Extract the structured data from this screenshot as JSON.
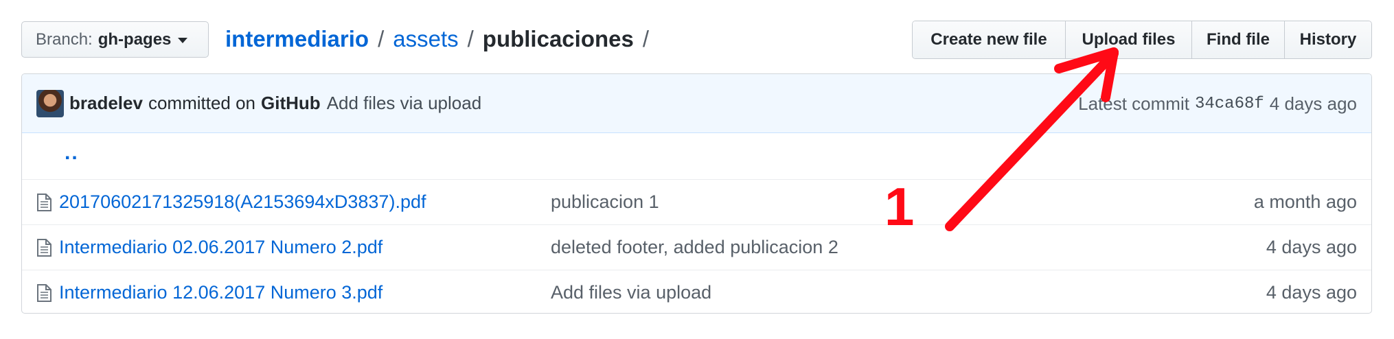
{
  "branch": {
    "label": "Branch:",
    "name": "gh-pages"
  },
  "breadcrumb": {
    "repo": "intermediario",
    "sep": "/",
    "folder": "assets",
    "current": "publicaciones"
  },
  "actions": [
    {
      "label": "Create new file"
    },
    {
      "label": "Upload files"
    },
    {
      "label": "Find file"
    },
    {
      "label": "History"
    }
  ],
  "commit": {
    "author": "bradelev",
    "committed_text": "committed on",
    "platform": "GitHub",
    "message": "Add files via upload",
    "latest_label": "Latest commit",
    "sha": "34ca68f",
    "age": "4 days ago"
  },
  "parent_link": "..",
  "files": [
    {
      "icon": "file-icon",
      "name": "20170602171325918(A2153694xD3837).pdf",
      "message": "publicacion 1",
      "age": "a month ago"
    },
    {
      "icon": "file-icon",
      "name": "Intermediario 02.06.2017 Numero 2.pdf",
      "message": "deleted footer, added publicacion 2",
      "age": "4 days ago"
    },
    {
      "icon": "file-icon",
      "name": "Intermediario 12.06.2017 Numero 3.pdf",
      "message": "Add files via upload",
      "age": "4 days ago"
    }
  ],
  "annotation": {
    "number": "1",
    "color": "#ff0a16"
  },
  "colors": {
    "link": "#0366d6",
    "commit_bar": "#f1f8ff",
    "muted": "#586069"
  }
}
